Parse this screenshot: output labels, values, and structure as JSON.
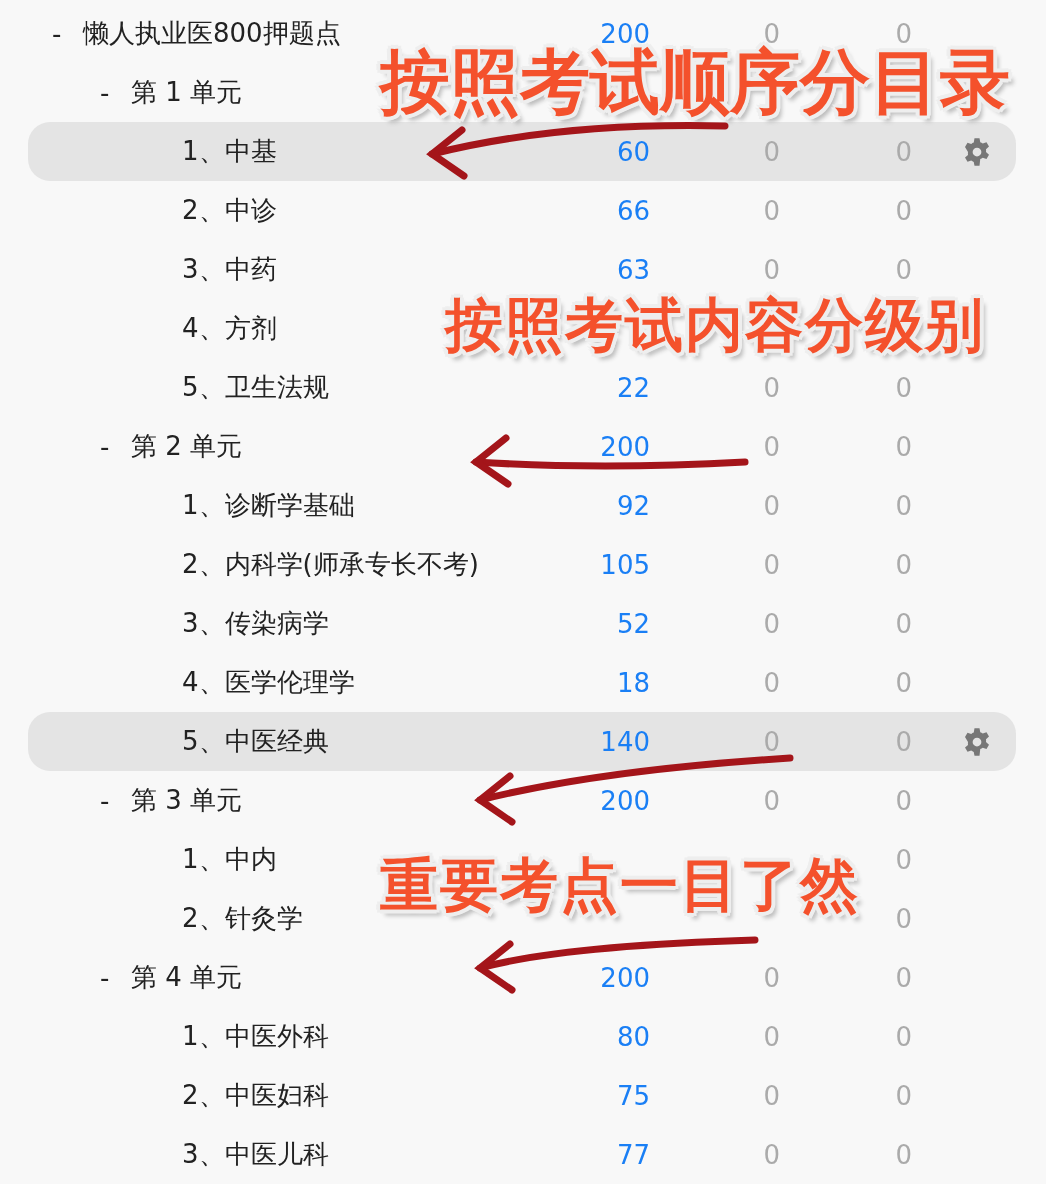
{
  "decks": [
    {
      "toggle": "-",
      "name": "懒人执业医800押题点",
      "column_2": "200",
      "column_3": "0",
      "column_4": "0",
      "selected": false,
      "children": [
        {
          "toggle": "-",
          "name": "第 1 单元",
          "selected": false,
          "children": [
            {
              "name": "1、中基",
              "column_2": "60",
              "column_3": "0",
              "column_4": "0",
              "selected": true
            },
            {
              "name": "2、中诊",
              "column_2": "66",
              "column_3": "0",
              "column_4": "0",
              "selected": false
            },
            {
              "name": "3、中药",
              "column_2": "63",
              "column_3": "0",
              "column_4": "0",
              "selected": false
            },
            {
              "name": "4、方剂",
              "selected": false
            },
            {
              "name": "5、卫生法规",
              "column_2": "22",
              "column_3": "0",
              "column_4": "0",
              "selected": false
            }
          ]
        },
        {
          "toggle": "-",
          "name": "第 2 单元",
          "column_2": "200",
          "column_3": "0",
          "column_4": "0",
          "selected": false,
          "children": [
            {
              "name": "1、诊断学基础",
              "column_2": "92",
              "column_3": "0",
              "column_4": "0",
              "selected": false
            },
            {
              "name": "2、内科学(师承专长不考)",
              "column_2": "105",
              "column_3": "0",
              "column_4": "0",
              "selected": false
            },
            {
              "name": "3、传染病学",
              "column_2": "52",
              "column_3": "0",
              "column_4": "0",
              "selected": false
            },
            {
              "name": "4、医学伦理学",
              "column_2": "18",
              "column_3": "0",
              "column_4": "0",
              "selected": false
            },
            {
              "name": "5、中医经典",
              "column_2": "140",
              "column_3": "0",
              "column_4": "0",
              "selected": true
            }
          ]
        },
        {
          "toggle": "-",
          "name": "第 3 单元",
          "column_2": "200",
          "column_3": "0",
          "column_4": "0",
          "selected": false,
          "children": [
            {
              "name": "1、中内",
              "column_4": "0",
              "selected": false
            },
            {
              "name": "2、针灸学",
              "column_4": "0",
              "selected": false
            }
          ]
        },
        {
          "toggle": "-",
          "name": "第 4 单元",
          "column_2": "200",
          "column_3": "0",
          "column_4": "0",
          "selected": false,
          "children": [
            {
              "name": "1、中医外科",
              "column_2": "80",
              "column_3": "0",
              "column_4": "0",
              "selected": false
            },
            {
              "name": "2、中医妇科",
              "column_2": "75",
              "column_3": "0",
              "column_4": "0",
              "selected": false
            },
            {
              "name": "3、中医儿科",
              "column_2": "77",
              "column_3": "0",
              "column_4": "0",
              "selected": false
            }
          ]
        }
      ]
    }
  ],
  "annotations": [
    {
      "text": "按照考试顺序分目录",
      "kind": "large"
    },
    {
      "text": "按照考试内容分级别",
      "kind": "medium"
    },
    {
      "text": "重要考点一目了然",
      "kind": "medium"
    }
  ]
}
